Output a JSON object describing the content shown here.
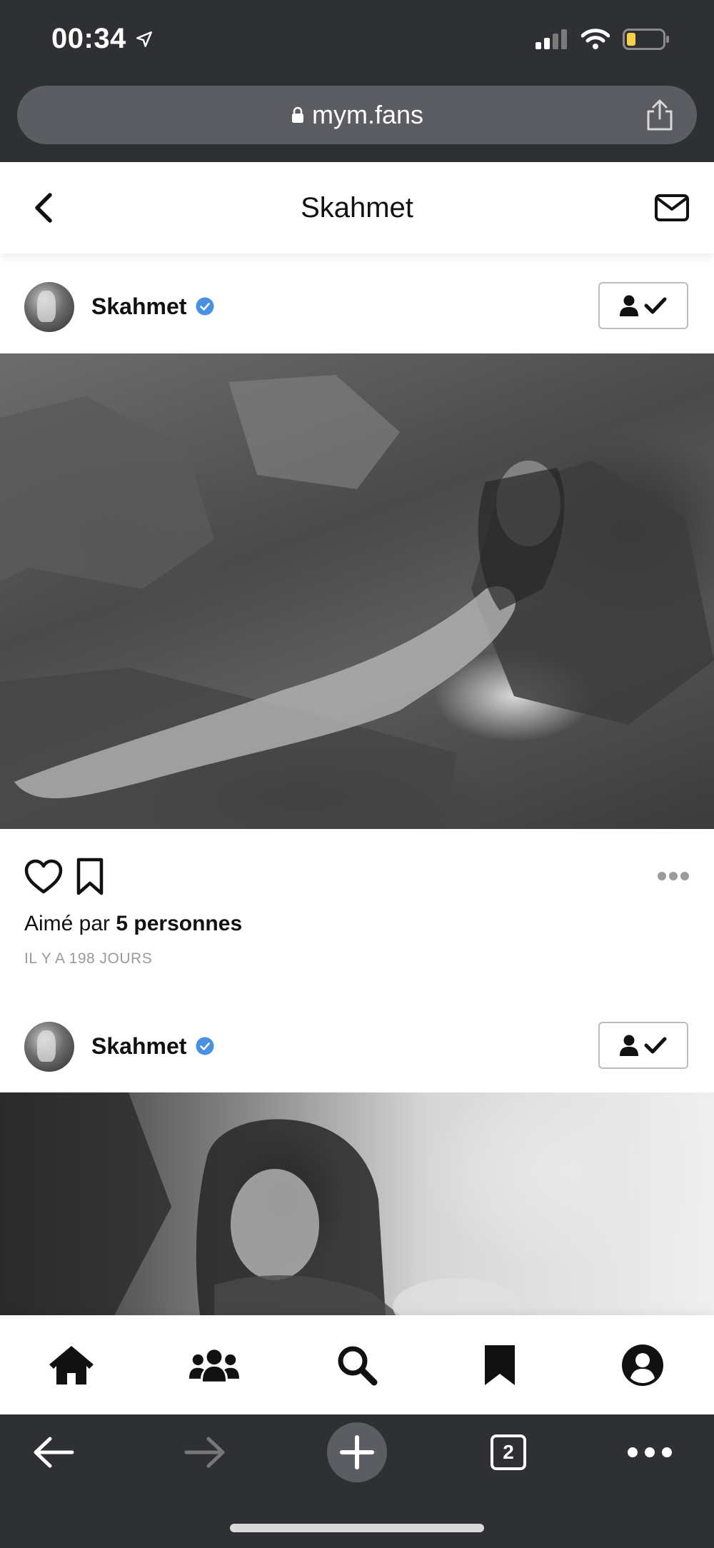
{
  "status_bar": {
    "time": "00:34"
  },
  "browser": {
    "url": "mym.fans",
    "tab_count": "2"
  },
  "header": {
    "title": "Skahmet"
  },
  "posts": [
    {
      "author": "Skahmet",
      "verified": true,
      "likes_prefix": "Aimé par ",
      "likes_count_text": "5 personnes",
      "timestamp": "IL Y A 198 JOURS"
    },
    {
      "author": "Skahmet",
      "verified": true
    }
  ],
  "bottom_nav": {
    "items": [
      "home-icon",
      "users-icon",
      "search-icon",
      "bookmark-icon",
      "profile-icon"
    ]
  },
  "colors": {
    "chrome_dark": "#2f3033",
    "url_bar": "#5b5d62",
    "verified_blue": "#4a90e2",
    "battery_yellow": "#f7d14a"
  }
}
